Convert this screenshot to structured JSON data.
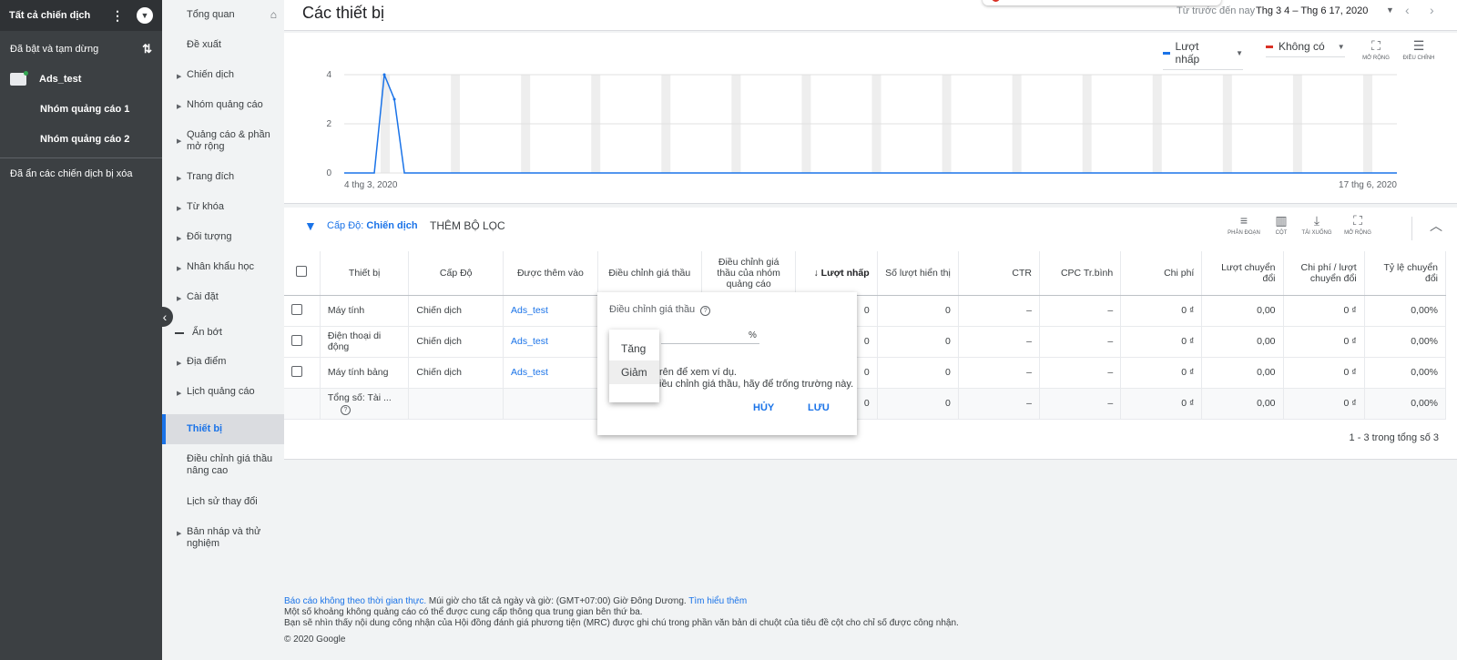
{
  "campaign_nav": {
    "header_title": "Tất cả chiến dịch",
    "filter_label": "Đã bật và tạm dừng",
    "account": "Ads_test",
    "ad_groups": [
      "Nhóm quảng cáo 1",
      "Nhóm quảng cáo 2"
    ],
    "hidden_removed": "Đã ẩn các chiến dịch bị xóa"
  },
  "page_nav": {
    "items": [
      {
        "label": "Tổng quan"
      },
      {
        "label": "Đề xuất"
      },
      {
        "label": "Chiến dịch"
      },
      {
        "label": "Nhóm quảng cáo"
      },
      {
        "label": "Quảng cáo & phần mở rộng"
      },
      {
        "label": "Trang đích"
      },
      {
        "label": "Từ khóa"
      },
      {
        "label": "Đối tượng"
      },
      {
        "label": "Nhân khẩu học"
      },
      {
        "label": "Cài đặt"
      },
      {
        "label": "Ẩn bớt"
      },
      {
        "label": "Địa điểm"
      },
      {
        "label": "Lịch quảng cáo"
      },
      {
        "label": "Thiết bị"
      },
      {
        "label": "Điều chỉnh giá thầu nâng cao"
      },
      {
        "label": "Lịch sử thay đổi"
      },
      {
        "label": "Bản nháp và thử nghiệm"
      }
    ]
  },
  "header": {
    "title": "Các thiết bị",
    "date_range_label": "Từ trước đến nay",
    "date_range_value": "Thg 3 4 – Thg 6 17, 2020"
  },
  "chart_controls": {
    "metric_1": "Lượt nhấp",
    "metric_2": "Không có",
    "expand_label": "MỞ RỘNG",
    "adjust_label": "ĐIỀU CHỈNH",
    "metric_1_color": "#1a73e8",
    "metric_2_color": "#d93025"
  },
  "chart_data": {
    "type": "line",
    "x_start_label": "4 thg 3, 2020",
    "x_end_label": "17 thg 6, 2020",
    "yticks": [
      "0",
      "2",
      "4"
    ],
    "ylim": [
      0,
      4
    ],
    "series": [
      {
        "name": "Lượt nhấp",
        "values": [
          0,
          0,
          0,
          0,
          4,
          3,
          0,
          0,
          0,
          0,
          0,
          0,
          0,
          0,
          0,
          0,
          0,
          0,
          0,
          0,
          0,
          0,
          0,
          0,
          0,
          0,
          0,
          0,
          0,
          0,
          0,
          0,
          0,
          0,
          0,
          0,
          0,
          0,
          0,
          0,
          0,
          0,
          0,
          0,
          0,
          0,
          0,
          0,
          0,
          0,
          0,
          0,
          0,
          0,
          0,
          0,
          0,
          0,
          0,
          0,
          0,
          0,
          0,
          0,
          0,
          0,
          0,
          0,
          0,
          0,
          0,
          0,
          0,
          0,
          0,
          0,
          0,
          0,
          0,
          0,
          0,
          0,
          0,
          0,
          0,
          0,
          0,
          0,
          0,
          0,
          0,
          0,
          0,
          0,
          0,
          0,
          0,
          0,
          0,
          0,
          0,
          0,
          0,
          0,
          0,
          0
        ]
      }
    ],
    "grid": true
  },
  "filter_bar": {
    "level_prefix": "Cấp Độ:",
    "level_value": "Chiến dịch",
    "add_filter": "THÊM BỘ LỌC",
    "segment_label": "PHÂN ĐOẠN",
    "columns_label": "CỘT",
    "download_label": "TẢI XUỐNG",
    "expand_label": "MỞ RỘNG"
  },
  "table": {
    "headers": [
      "Thiết bị",
      "Cấp Độ",
      "Được thêm vào",
      "Điều chỉnh giá thầu",
      "Điều chỉnh giá thầu của nhóm quảng cáo",
      "Lượt nhấp",
      "Số lượt hiển thị",
      "CTR",
      "CPC Tr.bình",
      "Chi phí",
      "Lượt chuyển đổi",
      "Chi phí / lượt chuyển đổi",
      "Tỷ lệ chuyển đổi"
    ],
    "rows": [
      {
        "device": "Máy tính",
        "level": "Chiến dịch",
        "added_to": "Ads_test",
        "bid_adj": "",
        "ag_bid_adj": "",
        "clicks": "0",
        "impr": "0",
        "ctr": "–",
        "cpc": "–",
        "cost": "0 ₫",
        "conv": "0,00",
        "cost_conv": "0 ₫",
        "conv_rate": "0,00%"
      },
      {
        "device": "Điện thoại di động",
        "level": "Chiến dịch",
        "added_to": "Ads_test",
        "bid_adj": "",
        "ag_bid_adj": "",
        "clicks": "0",
        "impr": "0",
        "ctr": "–",
        "cpc": "–",
        "cost": "0 ₫",
        "conv": "0,00",
        "cost_conv": "0 ₫",
        "conv_rate": "0,00%"
      },
      {
        "device": "Máy tính bảng",
        "level": "Chiến dịch",
        "added_to": "Ads_test",
        "bid_adj": "",
        "ag_bid_adj": "",
        "clicks": "0",
        "impr": "0",
        "ctr": "–",
        "cpc": "–",
        "cost": "0 ₫",
        "conv": "0,00",
        "cost_conv": "0 ₫",
        "conv_rate": "0,00%"
      }
    ],
    "total": {
      "label": "Tổng số: Tài ...",
      "clicks": "0",
      "impr": "0",
      "ctr": "–",
      "cpc": "–",
      "cost": "0 ₫",
      "conv": "0,00",
      "cost_conv": "0 ₫",
      "conv_rate": "0,00%"
    },
    "pager": "1 - 3 trong tổng số 3"
  },
  "popup": {
    "title": "Điều chỉnh giá thầu",
    "percent": "%",
    "hint_1": "rên để xem ví dụ.",
    "hint_2": "iều chỉnh giá thầu, hãy để trống trường này.",
    "cancel": "HỦY",
    "save": "LƯU",
    "options": [
      "Tăng",
      "Giảm"
    ],
    "selected_option": "Giảm"
  },
  "footer": {
    "link_1": "Báo cáo không theo thời gian thực.",
    "text_1": " Múi giờ cho tất cả ngày và giờ: (GMT+07:00) Giờ Đông Dương. ",
    "link_2": "Tìm hiểu thêm",
    "line_2": "Một số khoảng không quảng cáo có thể được cung cấp thông qua trung gian bên thứ ba.",
    "line_3": "Bạn sẽ nhìn thấy nội dung công nhận của Hội đồng đánh giá phương tiện (MRC) được ghi chú trong phần văn bản di chuột của tiêu đề cột cho chỉ số được công nhận.",
    "copyright": "© 2020 Google"
  }
}
